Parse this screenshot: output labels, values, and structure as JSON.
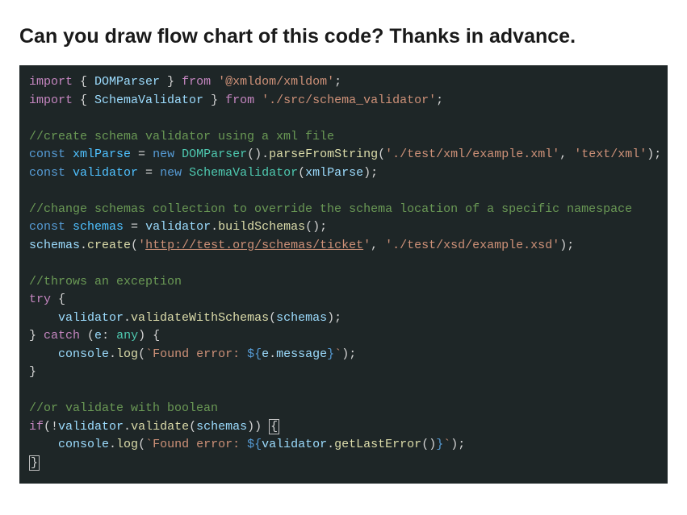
{
  "heading": "Can you draw flow chart of this code? Thanks in advance.",
  "code": {
    "l1_a": "import",
    "l1_b": " { ",
    "l1_c": "DOMParser",
    "l1_d": " } ",
    "l1_e": "from",
    "l1_f": " ",
    "l1_g": "'@xmldom/xmldom'",
    "l1_h": ";",
    "l2_a": "import",
    "l2_b": " { ",
    "l2_c": "SchemaValidator",
    "l2_d": " } ",
    "l2_e": "from",
    "l2_f": " ",
    "l2_g": "'./src/schema_validator'",
    "l2_h": ";",
    "l4_comment": "//create schema validator using a xml file",
    "l5_a": "const",
    "l5_b": " ",
    "l5_c": "xmlParse",
    "l5_d": " = ",
    "l5_e": "new",
    "l5_f": " ",
    "l5_g": "DOMParser",
    "l5_h": "().",
    "l5_i": "parseFromString",
    "l5_j": "(",
    "l5_k": "'./test/xml/example.xml'",
    "l5_l": ", ",
    "l5_m": "'text/xml'",
    "l5_n": ");",
    "l6_a": "const",
    "l6_b": " ",
    "l6_c": "validator",
    "l6_d": " = ",
    "l6_e": "new",
    "l6_f": " ",
    "l6_g": "SchemaValidator",
    "l6_h": "(",
    "l6_i": "xmlParse",
    "l6_j": ");",
    "l8_comment": "//change schemas collection to override the schema location of a specific namespace",
    "l9_a": "const",
    "l9_b": " ",
    "l9_c": "schemas",
    "l9_d": " = ",
    "l9_e": "validator",
    "l9_f": ".",
    "l9_g": "buildSchemas",
    "l9_h": "();",
    "l10_a": "schemas",
    "l10_b": ".",
    "l10_c": "create",
    "l10_d": "(",
    "l10_e": "'",
    "l10_f": "http://test.org/schemas/ticket",
    "l10_g": "'",
    "l10_h": ", ",
    "l10_i": "'./test/xsd/example.xsd'",
    "l10_j": ");",
    "l12_comment": "//throws an exception",
    "l13_a": "try",
    "l13_b": " {",
    "l14_pad": "    ",
    "l14_a": "validator",
    "l14_b": ".",
    "l14_c": "validateWithSchemas",
    "l14_d": "(",
    "l14_e": "schemas",
    "l14_f": ");",
    "l15_a": "} ",
    "l15_b": "catch",
    "l15_c": " (",
    "l15_d": "e",
    "l15_e": ": ",
    "l15_f": "any",
    "l15_g": ") {",
    "l16_pad": "    ",
    "l16_a": "console",
    "l16_b": ".",
    "l16_c": "log",
    "l16_d": "(",
    "l16_e": "`Found error: ",
    "l16_f": "${",
    "l16_g": "e",
    "l16_h": ".",
    "l16_i": "message",
    "l16_j": "}",
    "l16_k": "`",
    "l16_l": ");",
    "l17_a": "}",
    "l19_comment": "//or validate with boolean",
    "l20_a": "if",
    "l20_b": "(!",
    "l20_c": "validator",
    "l20_d": ".",
    "l20_e": "validate",
    "l20_f": "(",
    "l20_g": "schemas",
    "l20_h": ")) ",
    "l20_i": "{",
    "l21_pad": "    ",
    "l21_a": "console",
    "l21_b": ".",
    "l21_c": "log",
    "l21_d": "(",
    "l21_e": "`Found error: ",
    "l21_f": "${",
    "l21_g": "validator",
    "l21_h": ".",
    "l21_i": "getLastError",
    "l21_j": "()",
    "l21_k": "}",
    "l21_l": "`",
    "l21_m": ");",
    "l22_a": "}"
  }
}
